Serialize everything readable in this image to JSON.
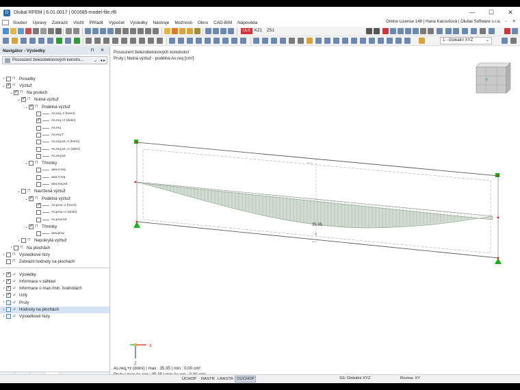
{
  "window": {
    "title": "Dlubal RFEM | 6.01.0017 | 001685-model-file.rf6",
    "controls": [
      "—",
      "☐",
      "✕"
    ]
  },
  "menu": {
    "items": [
      "Soubor",
      "Úpravy",
      "Zobrazit",
      "Vložit",
      "Přiřadit",
      "Výpočet",
      "Výsledky",
      "Nástroje",
      "Možnosti",
      "Okno",
      "CAD-BIM",
      "Nápověda"
    ],
    "license": "Online License 148 | Hana Karoušová | Dlubal Software s.r.o.",
    "mdi_controls": "– ▫ ✕"
  },
  "toolbar": {
    "load_case_badge": "ULS",
    "load_case_id": "KZ1",
    "load_case_name": "ZS1",
    "coord_system": "1 - Globální XYZ"
  },
  "navigator": {
    "title": "Navigátor - Výsledky",
    "header_controls": "⊓ ✕",
    "combo": "Posouzení železobetonových konstru...",
    "combo_nav": "◂ ▸",
    "tree": [
      {
        "label": "Posudky",
        "level": 0,
        "exp": "›",
        "cb": "off"
      },
      {
        "label": "Výztuž",
        "level": 0,
        "exp": "⌄",
        "cb": "on"
      },
      {
        "label": "Na prutech",
        "level": 1,
        "exp": "⌄",
        "cb": "on"
      },
      {
        "label": "Nutná výztuž",
        "level": 2,
        "exp": "⌄",
        "cb": "on"
      },
      {
        "label": "Podélná výztuž",
        "level": 3,
        "exp": "⌄",
        "cb": "on"
      },
      {
        "label": "As,req,-z (horní)",
        "level": 4,
        "exp": "",
        "cb": "off",
        "leaf": true
      },
      {
        "label": "As,req,+z (dolní)",
        "level": 4,
        "exp": "",
        "cb": "on",
        "leaf": true
      },
      {
        "label": "As,req",
        "level": 4,
        "exp": "",
        "cb": "off",
        "leaf": true
      },
      {
        "label": "As,req,T",
        "level": 4,
        "exp": "",
        "cb": "off",
        "leaf": true
      },
      {
        "label": "As,req,tot,-z (horní)",
        "level": 4,
        "exp": "",
        "cb": "off",
        "leaf": true
      },
      {
        "label": "As,req,tot,+z (dolní)",
        "level": 4,
        "exp": "",
        "cb": "off",
        "leaf": true
      },
      {
        "label": "As,req,tot",
        "level": 4,
        "exp": "",
        "cb": "off",
        "leaf": true
      },
      {
        "label": "Třmínky",
        "level": 3,
        "exp": "⌄",
        "cb": "off"
      },
      {
        "label": "asw,V,req",
        "level": 4,
        "exp": "",
        "cb": "off",
        "leaf": true
      },
      {
        "label": "asw,T,req",
        "level": 4,
        "exp": "",
        "cb": "off",
        "leaf": true
      },
      {
        "label": "asw,req,tot",
        "level": 4,
        "exp": "",
        "cb": "off",
        "leaf": true
      },
      {
        "label": "Navržená výztuž",
        "level": 2,
        "exp": "⌄",
        "cb": "off"
      },
      {
        "label": "Podélná výztuž",
        "level": 3,
        "exp": "⌄",
        "cb": "on"
      },
      {
        "label": "As,prov,-z (horní)",
        "level": 4,
        "exp": "",
        "cb": "on",
        "leaf": true
      },
      {
        "label": "As,prov,+z (dolní)",
        "level": 4,
        "exp": "",
        "cb": "off",
        "leaf": true
      },
      {
        "label": "As,prov,tot",
        "level": 4,
        "exp": "",
        "cb": "off",
        "leaf": true
      },
      {
        "label": "Třmínky",
        "level": 3,
        "exp": "⌄",
        "cb": "on"
      },
      {
        "label": "asw,prov",
        "level": 4,
        "exp": "",
        "cb": "off",
        "leaf": true
      },
      {
        "label": "Nepokrytá výztuž",
        "level": 2,
        "exp": "›",
        "cb": "off"
      },
      {
        "label": "Na plochách",
        "level": 1,
        "exp": "›",
        "cb": "off"
      },
      {
        "label": "Výsledkové řezy",
        "level": 0,
        "exp": "›",
        "cb": "off"
      },
      {
        "label": "Zobrazit hodnoty na plochách",
        "level": 0,
        "exp": "",
        "cb": "off"
      }
    ],
    "tree2": [
      {
        "label": "Výsledky",
        "cb": "on",
        "sel": false
      },
      {
        "label": "Informace v záhlaví",
        "cb": "on",
        "sel": false
      },
      {
        "label": "Informace o max./min. hodnotách",
        "cb": "on",
        "sel": false
      },
      {
        "label": "Uzly",
        "cb": "on",
        "sel": false
      },
      {
        "label": "Pruty",
        "cb": "blue",
        "sel": false
      },
      {
        "label": "Hodnoty na plochách",
        "cb": "blue",
        "sel": true
      },
      {
        "label": "Výsledkové řezy",
        "cb": "blue",
        "sel": false
      }
    ],
    "tabs": [
      "⧉",
      "◉",
      "▶",
      "⟿"
    ]
  },
  "view": {
    "title": "Posouzení železobetonových konstrukcí",
    "subtitle": "Pruty | Nutná výztuž - podélná As,req [cm²]",
    "value_label": "35.35",
    "axis_x": "X",
    "axis_y": "Y",
    "axis_z": "Z",
    "footer_line1": "As,req,+z (dolní) | max : 35.35 | min : 0.00 cm²",
    "footer_line2": "Pruty | max As,req : 35.35 | min As,req : 0.00 cm²",
    "colors": {
      "diagram_fill": "#d2dcd2",
      "diagram_stroke": "#7f9a84",
      "support_green": "#18b218",
      "node_red": "#e01b1b"
    }
  },
  "statusbar": {
    "buttons": [
      {
        "label": "ÚCHOP",
        "active": false
      },
      {
        "label": "RASTR",
        "active": false
      },
      {
        "label": "LRASTR",
        "active": false
      },
      {
        "label": "OUCHOP",
        "active": true
      }
    ],
    "cs": "SS: Globální XYZ",
    "plane": "Rovina: XY"
  }
}
